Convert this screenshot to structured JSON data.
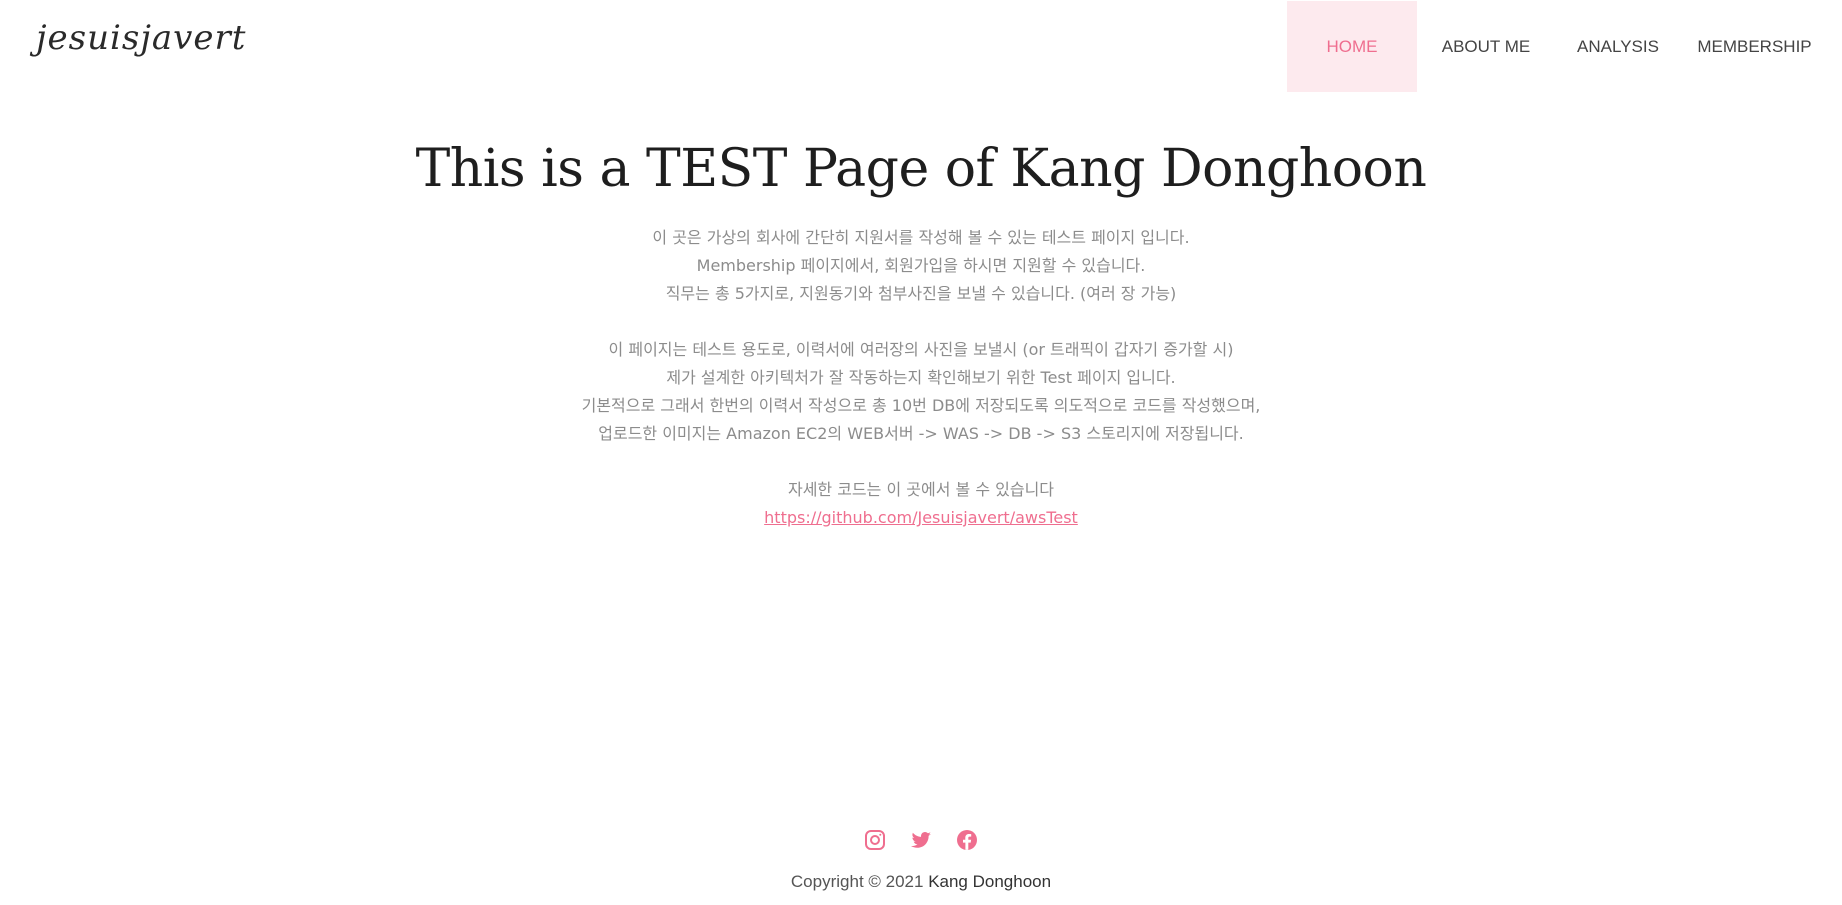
{
  "header": {
    "logo_text": "jesuisjavert",
    "nav": [
      {
        "label": "HOME",
        "active": true
      },
      {
        "label": "ABOUT ME",
        "active": false
      },
      {
        "label": "ANALYSIS",
        "active": false
      },
      {
        "label": "MEMBERSHIP",
        "active": false
      }
    ]
  },
  "main": {
    "title": "This is a TEST Page of Kang Donghoon",
    "paragraphs": [
      "이 곳은 가상의 회사에 간단히 지원서를 작성해 볼 수 있는 테스트 페이지 입니다.",
      "Membership 페이지에서, 회원가입을 하시면 지원할 수 있습니다.",
      "직무는 총 5가지로, 지원동기와 첨부사진을 보낼 수 있습니다. (여러 장 가능)",
      "이 페이지는 테스트 용도로, 이력서에 여러장의 사진을 보낼시 (or 트래픽이 갑자기 증가할 시)",
      "제가 설계한 아키텍처가 잘 작동하는지 확인해보기 위한 Test 페이지 입니다.",
      "기본적으로 그래서 한번의 이력서 작성으로 총 10번 DB에 저장되도록 의도적으로 코드를 작성했으며,",
      "업로드한 이미지는 Amazon EC2의 WEB서버 -> WAS -> DB -> S3 스토리지에 저장됩니다.",
      "자세한 코드는 이 곳에서 볼 수 있습니다"
    ],
    "code_link": "https://github.com/Jesuisjavert/awsTest"
  },
  "footer": {
    "social_icons": [
      "instagram-icon",
      "twitter-icon",
      "facebook-icon"
    ],
    "copyright_prefix": "Copyright © 2021",
    "copyright_owner": "Kang Donghoon"
  },
  "colors": {
    "accent": "#ef6e8f",
    "active_nav_bg": "#fdeaee",
    "body_text": "#8c8c8c",
    "title_text": "#1e1e1e"
  }
}
